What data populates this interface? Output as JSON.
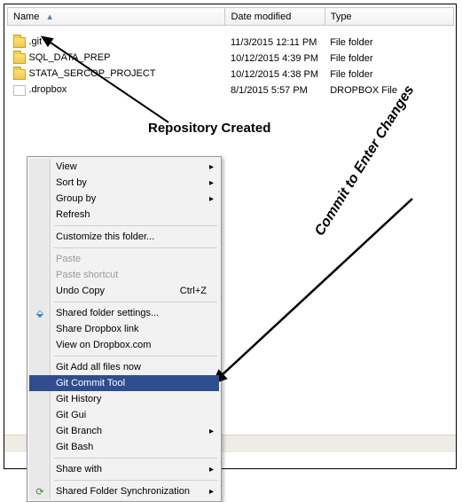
{
  "columns": {
    "name": "Name",
    "date": "Date modified",
    "type": "Type"
  },
  "files": [
    {
      "name": ".git",
      "date": "11/3/2015 12:11 PM",
      "type": "File folder",
      "icon": "folder"
    },
    {
      "name": "SQL_DATA_PREP",
      "date": "10/12/2015 4:39 PM",
      "type": "File folder",
      "icon": "folder"
    },
    {
      "name": "STATA_SERCOP_PROJECT",
      "date": "10/12/2015 4:38 PM",
      "type": "File folder",
      "icon": "folder"
    },
    {
      "name": ".dropbox",
      "date": "8/1/2015 5:57 PM",
      "type": "DROPBOX File",
      "icon": "doc"
    }
  ],
  "annot1": "Repository Created",
  "annot2": "Commit to Enter Changes",
  "menu": {
    "groups": [
      [
        {
          "label": "View",
          "sub": true
        },
        {
          "label": "Sort by",
          "sub": true
        },
        {
          "label": "Group by",
          "sub": true
        },
        {
          "label": "Refresh"
        }
      ],
      [
        {
          "label": "Customize this folder..."
        }
      ],
      [
        {
          "label": "Paste",
          "disabled": true
        },
        {
          "label": "Paste shortcut",
          "disabled": true
        },
        {
          "label": "Undo Copy",
          "shortcut": "Ctrl+Z"
        }
      ],
      [
        {
          "label": "Shared folder settings...",
          "icon": "dropbox"
        },
        {
          "label": "Share Dropbox link"
        },
        {
          "label": "View on Dropbox.com"
        }
      ],
      [
        {
          "label": "Git Add all files now"
        },
        {
          "label": "Git Commit Tool",
          "selected": true
        },
        {
          "label": "Git History"
        },
        {
          "label": "Git Gui"
        },
        {
          "label": "Git Branch",
          "sub": true
        },
        {
          "label": "Git Bash"
        }
      ],
      [
        {
          "label": "Share with",
          "sub": true
        }
      ],
      [
        {
          "label": "Shared Folder Synchronization",
          "sub": true,
          "icon": "sync"
        }
      ]
    ]
  }
}
